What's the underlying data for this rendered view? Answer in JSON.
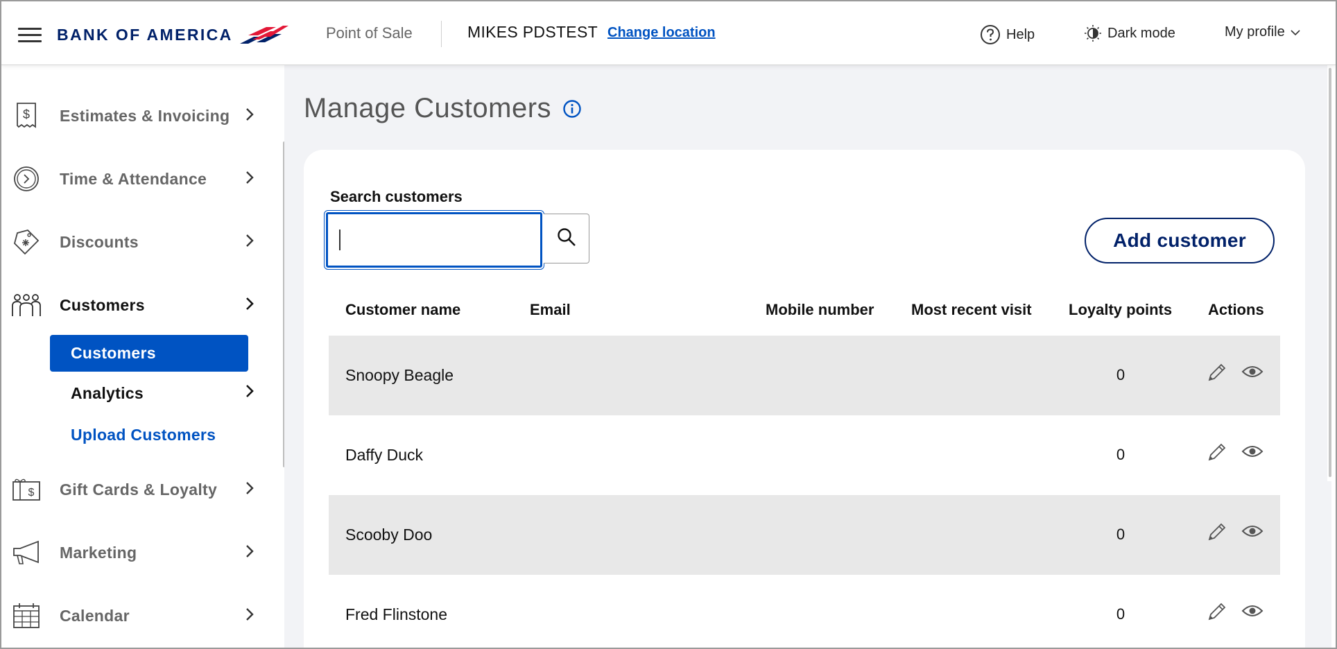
{
  "header": {
    "brand": "BANK OF AMERICA",
    "product": "Point of Sale",
    "location": "MIKES PDSTEST",
    "change_location": "Change location",
    "help": "Help",
    "dark_mode": "Dark mode",
    "profile": "My profile"
  },
  "sidebar": {
    "items": [
      {
        "label": "Estimates & Invoicing",
        "icon": "receipt-dollar-icon"
      },
      {
        "label": "Time & Attendance",
        "icon": "clock-icon"
      },
      {
        "label": "Discounts",
        "icon": "discount-tag-icon"
      },
      {
        "label": "Customers",
        "icon": "people-icon"
      },
      {
        "label": "Gift Cards & Loyalty",
        "icon": "gift-card-icon"
      },
      {
        "label": "Marketing",
        "icon": "megaphone-icon"
      },
      {
        "label": "Calendar",
        "icon": "calendar-icon"
      }
    ],
    "sub_items": {
      "customers": "Customers",
      "analytics": "Analytics",
      "upload": "Upload Customers"
    }
  },
  "main": {
    "title": "Manage Customers",
    "search_label": "Search customers",
    "search_value": "",
    "add_customer": "Add customer",
    "columns": [
      "Customer name",
      "Email",
      "Mobile number",
      "Most recent visit",
      "Loyalty points",
      "Actions"
    ],
    "rows": [
      {
        "name": "Snoopy Beagle",
        "email": "",
        "mobile": "",
        "recent": "",
        "loyalty": "0"
      },
      {
        "name": "Daffy Duck",
        "email": "",
        "mobile": "",
        "recent": "",
        "loyalty": "0"
      },
      {
        "name": "Scooby Doo",
        "email": "",
        "mobile": "",
        "recent": "",
        "loyalty": "0"
      },
      {
        "name": "Fred Flinstone",
        "email": "",
        "mobile": "",
        "recent": "",
        "loyalty": "0"
      }
    ]
  },
  "colors": {
    "brand_navy": "#012169",
    "accent_blue": "#0053c2",
    "brand_red": "#e31837",
    "row_shade": "#e8e8e8",
    "page_bg": "#f2f3f6"
  }
}
